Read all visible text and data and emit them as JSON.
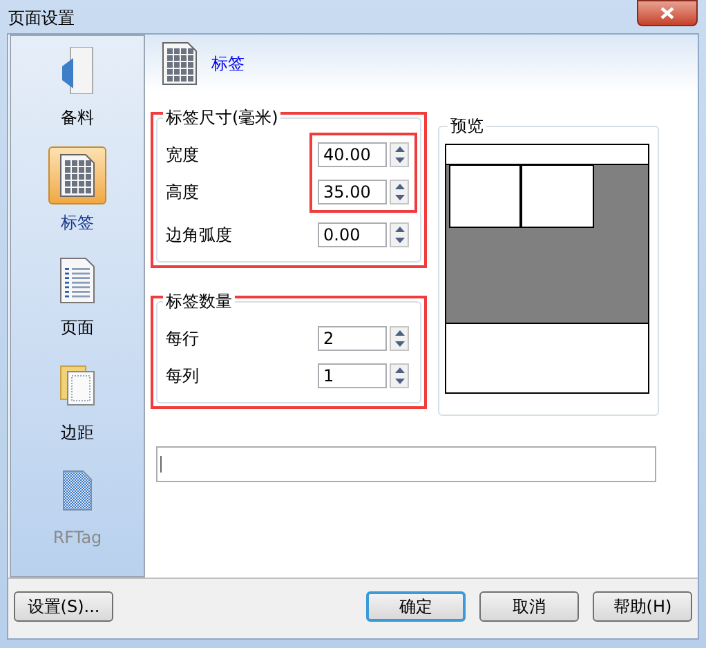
{
  "window": {
    "title": "页面设置"
  },
  "sidebar": {
    "items": [
      {
        "kind": "material",
        "label": "备料",
        "selected": false,
        "disabled": false
      },
      {
        "kind": "label",
        "label": "标签",
        "selected": true,
        "disabled": false
      },
      {
        "kind": "page",
        "label": "页面",
        "selected": false,
        "disabled": false
      },
      {
        "kind": "margin",
        "label": "边距",
        "selected": false,
        "disabled": false
      },
      {
        "kind": "rftag",
        "label": "RFTag",
        "selected": false,
        "disabled": true
      }
    ]
  },
  "header": {
    "title": "标签"
  },
  "size_group": {
    "title": "标签尺寸(毫米)",
    "highlighted": true,
    "fields": [
      {
        "label": "宽度",
        "value": "40.00",
        "highlighted": true
      },
      {
        "label": "高度",
        "value": "35.00",
        "highlighted": true
      },
      {
        "label": "边角弧度",
        "value": "0.00",
        "highlighted": false
      }
    ]
  },
  "count_group": {
    "title": "标签数量",
    "highlighted": true,
    "fields": [
      {
        "label": "每行",
        "value": "2",
        "highlighted": false
      },
      {
        "label": "每列",
        "value": "1",
        "highlighted": false
      }
    ]
  },
  "preview": {
    "title": "预览"
  },
  "buttons": [
    {
      "label": "设置(S)...",
      "default": false
    },
    {
      "label": "确定",
      "default": true
    },
    {
      "label": "取消",
      "default": false
    },
    {
      "label": "帮助(H)",
      "default": false
    }
  ]
}
